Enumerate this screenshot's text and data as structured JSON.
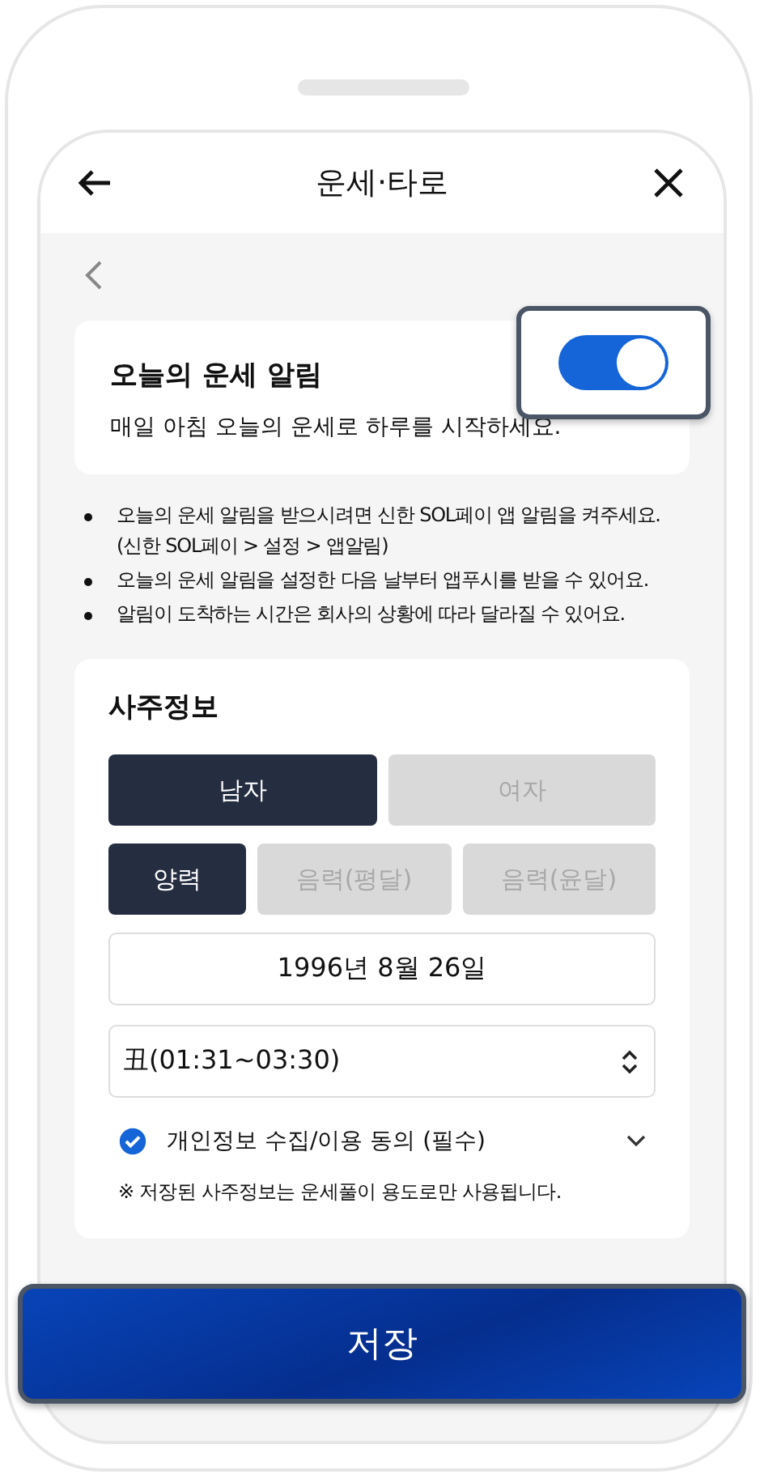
{
  "header": {
    "title": "운세·타로"
  },
  "notification_card": {
    "title": "오늘의 운세 알림",
    "description": "매일 아침 오늘의 운세로 하루를 시작하세요.",
    "toggle": {
      "on": true
    }
  },
  "notes": [
    "오늘의 운세 알림을 받으시려면 신한 SOL페이 앱 알림을 켜주세요. (신한 SOL페이 > 설정 > 앱알림)",
    "오늘의 운세 알림을 설정한 다음 날부터 앱푸시를 받을 수 있어요.",
    "알림이 도착하는 시간은 회사의 상황에 따라 달라질 수 있어요."
  ],
  "saju_card": {
    "title": "사주정보",
    "gender_options": [
      {
        "label": "남자",
        "selected": true
      },
      {
        "label": "여자",
        "selected": false
      }
    ],
    "calendar_options": [
      {
        "label": "양력",
        "selected": true
      },
      {
        "label": "음력(평달)",
        "selected": false
      },
      {
        "label": "음력(윤달)",
        "selected": false
      }
    ],
    "birth_date": "1996년 8월 26일",
    "birth_time": "丑(01:31~03:30)",
    "consent": {
      "label": "개인정보 수집/이용 동의 (필수)",
      "checked": true
    },
    "notice": "※ 저장된 사주정보는 운세풀이 용도로만 사용됩니다."
  },
  "save_button": "저장"
}
